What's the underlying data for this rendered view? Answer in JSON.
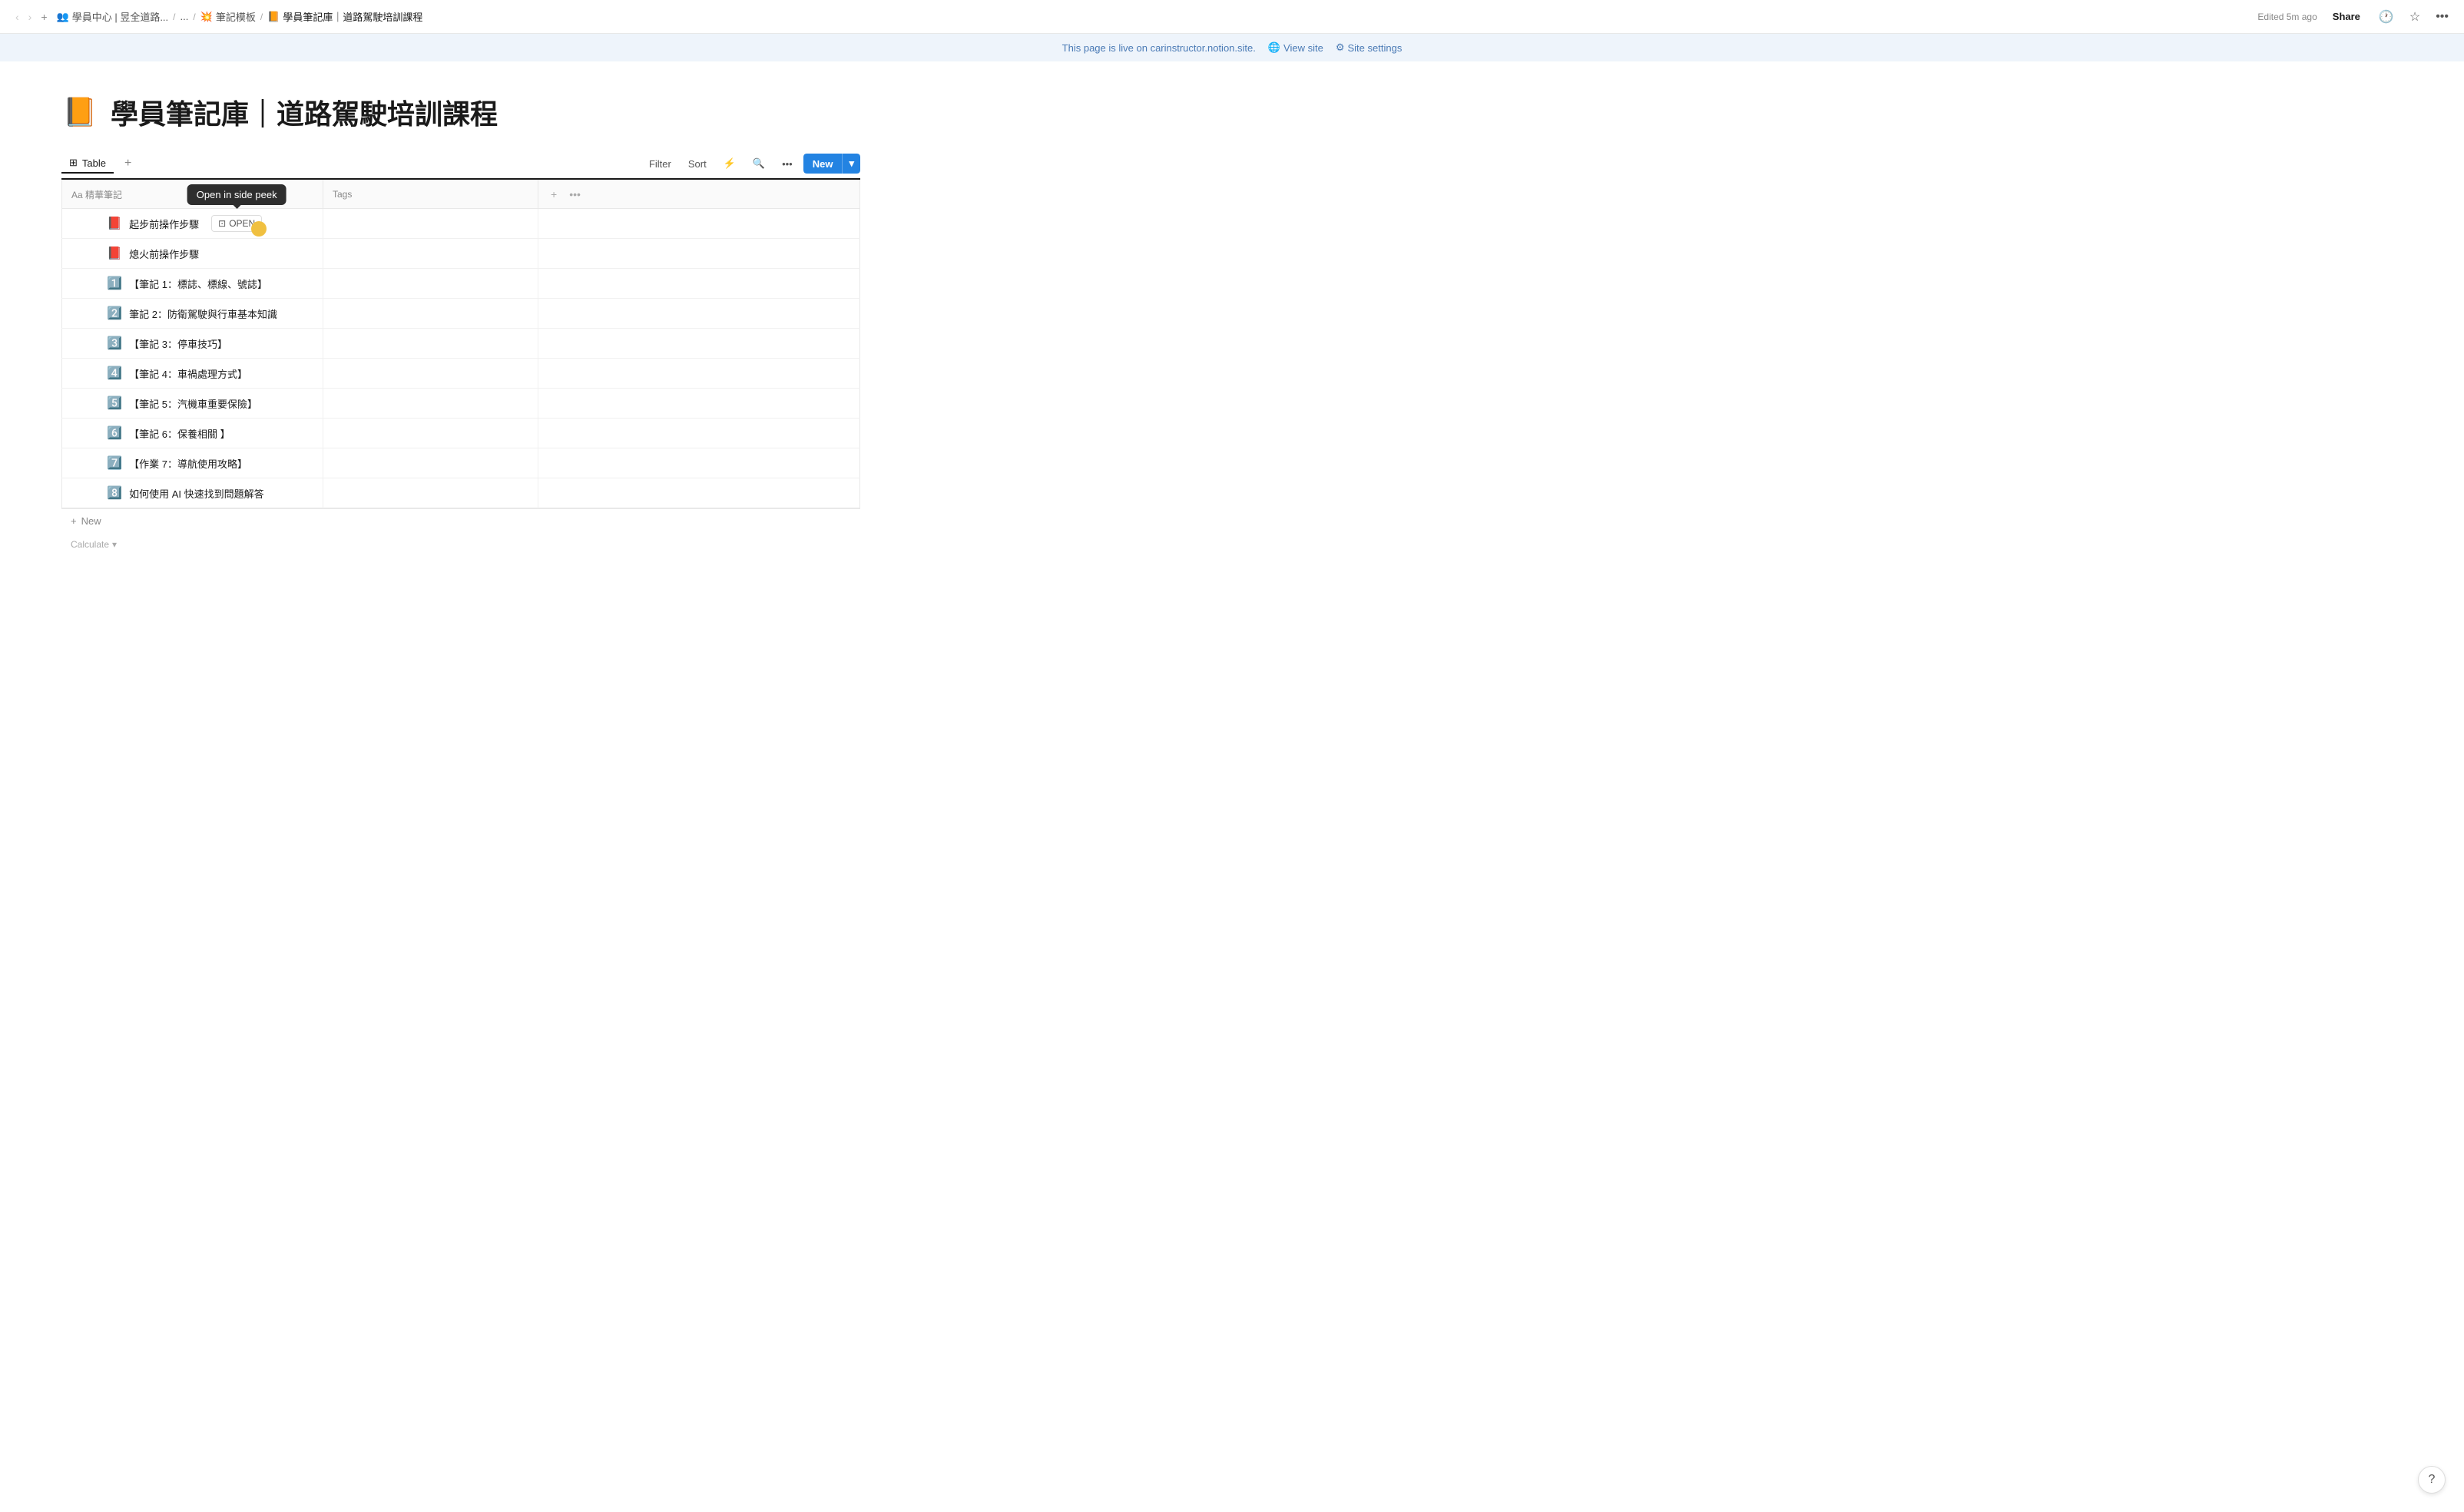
{
  "nav": {
    "back_disabled": true,
    "forward_disabled": true,
    "add_label": "+",
    "breadcrumbs": [
      {
        "icon": "👥",
        "label": "學員中心 | 昱全道路..."
      },
      {
        "sep": "/"
      },
      {
        "label": "..."
      },
      {
        "sep": "/"
      },
      {
        "icon": "💥",
        "label": "筆記模板"
      },
      {
        "sep": "/"
      },
      {
        "icon": "📙",
        "label": "學員筆記庫｜道路駕駛培訓課程"
      }
    ],
    "edited": "Edited 5m ago",
    "share": "Share"
  },
  "banner": {
    "text": "This page is live on carinstructor.notion.site.",
    "view_site": "View site",
    "site_settings": "Site settings"
  },
  "page": {
    "icon": "📙",
    "title": "學員筆記庫｜道路駕駛培訓課程"
  },
  "table": {
    "tab_label": "Table",
    "filter_label": "Filter",
    "sort_label": "Sort",
    "new_label": "New",
    "col_name": "Aa 精華筆記",
    "col_tags": "Tags",
    "rows": [
      {
        "icon": "📕",
        "name": "起步前操作步驟",
        "tags": ""
      },
      {
        "icon": "📕",
        "name": "熄火前操作步驟",
        "tags": ""
      },
      {
        "icon": "1️⃣",
        "name": "【筆記 1：標誌、標線、號誌】",
        "tags": ""
      },
      {
        "icon": "2️⃣",
        "name": "筆記 2：防衛駕駛與行車基本知識",
        "tags": ""
      },
      {
        "icon": "3️⃣",
        "name": "【筆記 3：停車技巧】",
        "tags": ""
      },
      {
        "icon": "4️⃣",
        "name": "【筆記 4：車禍處理方式】",
        "tags": ""
      },
      {
        "icon": "5️⃣",
        "name": "【筆記 5：汽機車重要保險】",
        "tags": ""
      },
      {
        "icon": "6️⃣",
        "name": "【筆記 6：保養相關 】",
        "tags": ""
      },
      {
        "icon": "7️⃣",
        "name": "【作業 7：導航使用攻略】",
        "tags": ""
      },
      {
        "icon": "8️⃣",
        "name": "如何使用 AI 快速找到問題解答",
        "tags": ""
      }
    ],
    "footer_new": "New",
    "calculate": "Calculate",
    "tooltip": "Open in side peek",
    "open_btn": "OPEN"
  }
}
